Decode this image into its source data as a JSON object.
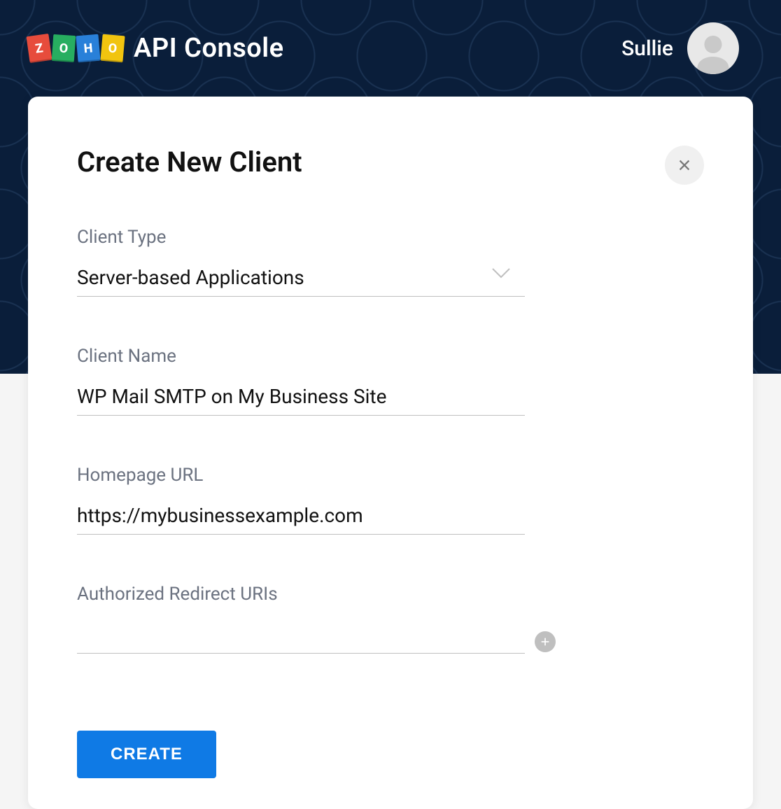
{
  "header": {
    "logo_letters": [
      "Z",
      "O",
      "H",
      "O"
    ],
    "title": "API Console",
    "user_name": "Sullie"
  },
  "card": {
    "title": "Create New Client",
    "fields": {
      "client_type": {
        "label": "Client Type",
        "value": "Server-based Applications"
      },
      "client_name": {
        "label": "Client Name",
        "value": "WP Mail SMTP on My Business Site"
      },
      "homepage_url": {
        "label": "Homepage URL",
        "value": "https://mybusinessexample.com"
      },
      "redirect_uris": {
        "label": "Authorized Redirect URIs",
        "value": ""
      }
    },
    "create_button": "CREATE"
  }
}
